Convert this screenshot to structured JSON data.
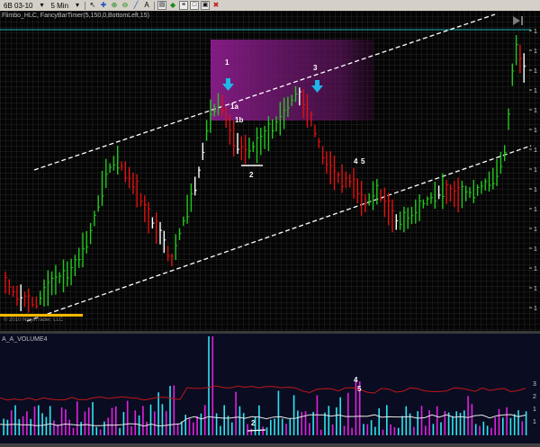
{
  "toolbar": {
    "instrument": "6B 03-10",
    "interval": "5 Min",
    "icons": [
      "cursor-icon",
      "crosshair-icon",
      "zoom-in-icon",
      "zoom-out-icon",
      "draw-line-icon",
      "text-icon",
      "properties-icon",
      "strategy-icon",
      "orders-icon",
      "data-box-icon",
      "window-icon",
      "close-icon"
    ]
  },
  "price_panel": {
    "indicator_label": "Flimbo_HLC, FancyBarTimer(5,150,0,BottomLeft,15)",
    "copyright": "© 2010 NinjaTrader, LLC",
    "colors": {
      "up": "#22c81e",
      "down": "#e01010",
      "neutral": "#ffffff",
      "band": "#7a1b7a",
      "hline": "#20c0c0",
      "arrow": "#1fb6ea",
      "support": "#f5b800"
    },
    "annotations": [
      {
        "id": "1",
        "text": "1"
      },
      {
        "id": "1a",
        "text": "1a"
      },
      {
        "id": "1b",
        "text": "1b"
      },
      {
        "id": "2",
        "text": "2"
      },
      {
        "id": "3",
        "text": "3"
      },
      {
        "id": "4",
        "text": "4"
      },
      {
        "id": "5",
        "text": "5"
      }
    ],
    "axis_labels": [
      "1",
      "1",
      "1",
      "1",
      "1",
      "1",
      "1",
      "1",
      "1",
      "1",
      "1",
      "1",
      "1",
      "1",
      "1"
    ]
  },
  "volume_panel": {
    "label": "A_A_VOLUME4",
    "annotations": [
      {
        "id": "2",
        "text": "2"
      },
      {
        "id": "4",
        "text": "4"
      },
      {
        "id": "5",
        "text": "5"
      }
    ],
    "axis_labels": [
      "3",
      "2",
      "1",
      "1"
    ],
    "colors": {
      "bar_up": "#2ee6f0",
      "bar_down": "#e020e0",
      "avg_high": "#c01818",
      "avg_low": "#e8e8e8"
    }
  }
}
